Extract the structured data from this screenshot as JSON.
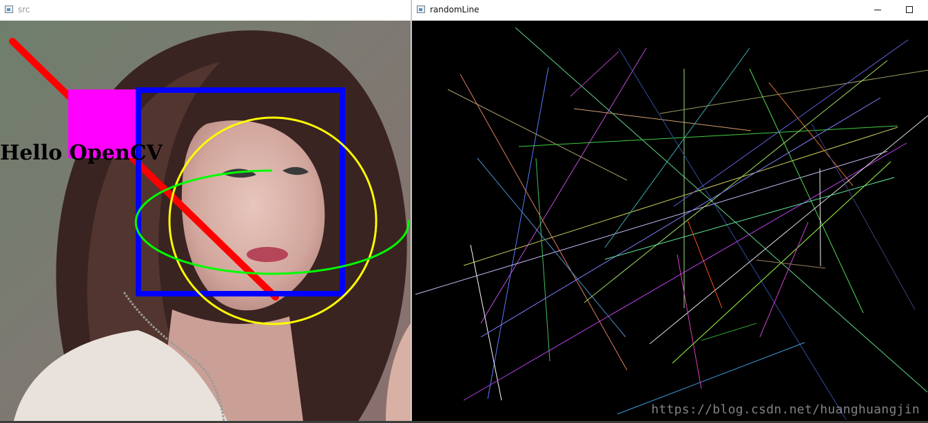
{
  "windows": {
    "src": {
      "title": "src"
    },
    "random_line": {
      "title": "randomLine"
    }
  },
  "src_image": {
    "overlay_text": "Hello OpenCV",
    "colors": {
      "line": "#ff0000",
      "rectangle": "#0000ff",
      "filled_square": "#ff00ff",
      "circle": "#ffff00",
      "ellipse": "#00ff00",
      "text": "#000000"
    }
  },
  "random_line_canvas": {
    "background": "#000000"
  },
  "watermark": "https://blog.csdn.net/huanghuangjin",
  "controls": {
    "minimize_icon": "minimize-icon",
    "maximize_icon": "maximize-icon"
  }
}
